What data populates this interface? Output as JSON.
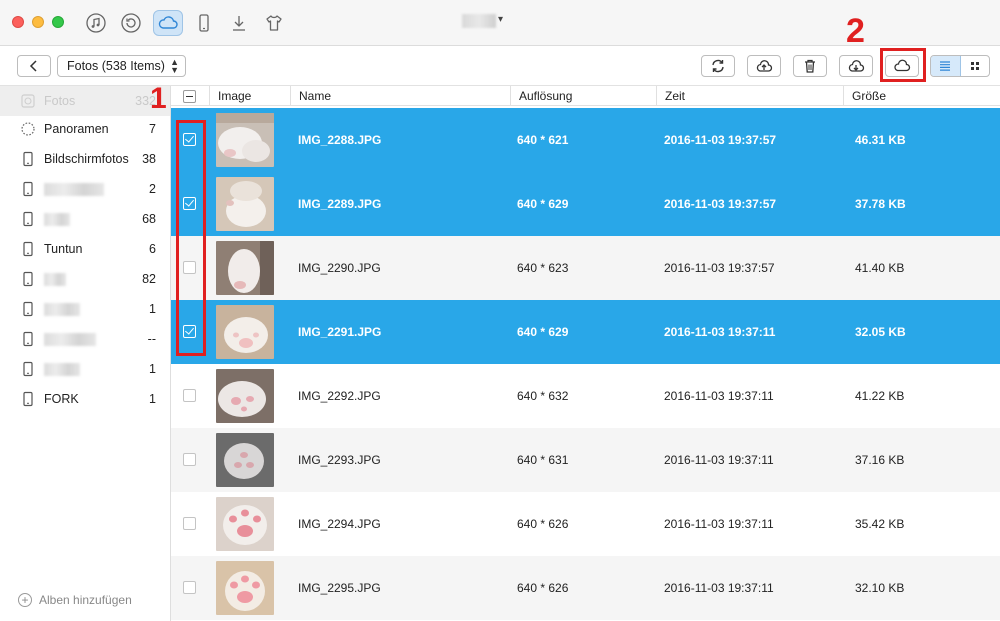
{
  "toolbar": {
    "album_dropdown": "Fotos (538 Items)"
  },
  "annotations": {
    "mark1": "1",
    "mark2": "2"
  },
  "sidebar": {
    "items": [
      {
        "label": "Fotos",
        "count": "332",
        "icon": "photos-icon"
      },
      {
        "label": "Panoramen",
        "count": "7",
        "icon": "panorama-icon"
      },
      {
        "label": "Bildschirmfotos",
        "count": "38",
        "icon": "phone-icon"
      },
      {
        "label": "",
        "count": "2",
        "icon": "phone-icon"
      },
      {
        "label": "",
        "count": "68",
        "icon": "phone-icon"
      },
      {
        "label": "Tuntun",
        "count": "6",
        "icon": "phone-icon"
      },
      {
        "label": "",
        "count": "82",
        "icon": "phone-icon"
      },
      {
        "label": "",
        "count": "1",
        "icon": "phone-icon"
      },
      {
        "label": "",
        "count": "--",
        "icon": "phone-icon"
      },
      {
        "label": "",
        "count": "1",
        "icon": "phone-icon"
      },
      {
        "label": "FORK",
        "count": "1",
        "icon": "phone-icon"
      }
    ],
    "add_albums": "Alben hinzufügen"
  },
  "table": {
    "columns": [
      "Image",
      "Name",
      "Auflösung",
      "Zeit",
      "Größe"
    ],
    "rows": [
      {
        "name": "IMG_2288.JPG",
        "resolution": "640 * 621",
        "time": "2016-11-03 19:37:57",
        "size": "46.31 KB",
        "selected": true
      },
      {
        "name": "IMG_2289.JPG",
        "resolution": "640 * 629",
        "time": "2016-11-03 19:37:57",
        "size": "37.78 KB",
        "selected": true
      },
      {
        "name": "IMG_2290.JPG",
        "resolution": "640 * 623",
        "time": "2016-11-03 19:37:57",
        "size": "41.40 KB",
        "selected": false
      },
      {
        "name": "IMG_2291.JPG",
        "resolution": "640 * 629",
        "time": "2016-11-03 19:37:11",
        "size": "32.05 KB",
        "selected": true
      },
      {
        "name": "IMG_2292.JPG",
        "resolution": "640 * 632",
        "time": "2016-11-03 19:37:11",
        "size": "41.22 KB",
        "selected": false
      },
      {
        "name": "IMG_2293.JPG",
        "resolution": "640 * 631",
        "time": "2016-11-03 19:37:11",
        "size": "37.16 KB",
        "selected": false
      },
      {
        "name": "IMG_2294.JPG",
        "resolution": "640 * 626",
        "time": "2016-11-03 19:37:11",
        "size": "35.42 KB",
        "selected": false
      },
      {
        "name": "IMG_2295.JPG",
        "resolution": "640 * 626",
        "time": "2016-11-03 19:37:11",
        "size": "32.10 KB",
        "selected": false
      }
    ]
  },
  "colors": {
    "selection": "#29a7e8",
    "annotation": "#e02020"
  }
}
